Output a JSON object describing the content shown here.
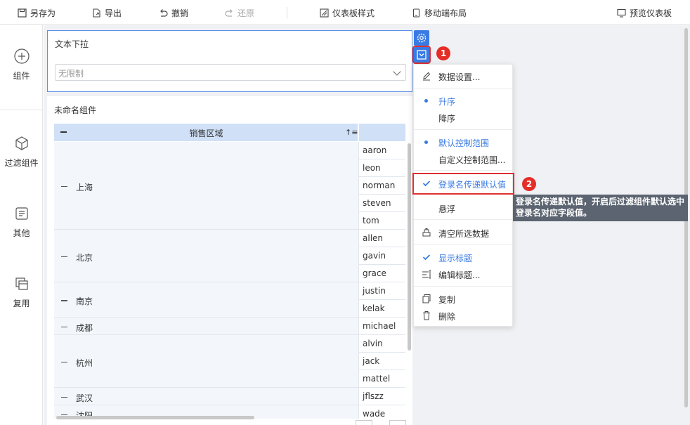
{
  "toolbar": {
    "save_as": "另存为",
    "export": "导出",
    "undo": "撤销",
    "redo": "还原",
    "dashboard_style": "仪表板样式",
    "mobile_layout": "移动端布局",
    "preview": "预览仪表板"
  },
  "sidebar": {
    "items": [
      {
        "label": "组件",
        "icon": "plus-circle-icon"
      },
      {
        "label": "过滤组件",
        "icon": "cube-icon"
      },
      {
        "label": "其他",
        "icon": "document-icon"
      },
      {
        "label": "复用",
        "icon": "layers-icon"
      }
    ]
  },
  "dropdown_widget": {
    "title": "文本下拉",
    "placeholder": "无限制"
  },
  "table_widget": {
    "title": "未命名组件",
    "header": "销售区域",
    "groups": [
      {
        "region": "上海",
        "names": [
          "aaron",
          "leon",
          "norman",
          "steven",
          "tom"
        ]
      },
      {
        "region": "北京",
        "names": [
          "allen",
          "gavin",
          "grace"
        ]
      },
      {
        "region": "南京",
        "names": [
          "justin",
          "kelak"
        ]
      },
      {
        "region": "成都",
        "names": [
          "michael"
        ]
      },
      {
        "region": "杭州",
        "names": [
          "alvin",
          "jack",
          "mattel"
        ]
      },
      {
        "region": "武汉",
        "names": [
          "jflszz"
        ]
      },
      {
        "region": "沈阳",
        "names": [
          "wade"
        ]
      }
    ]
  },
  "menu": {
    "data_settings": "数据设置...",
    "asc": "升序",
    "desc": "降序",
    "default_range": "默认控制范围",
    "custom_range": "自定义控制范围...",
    "login_default": "登录名传递默认值",
    "float": "悬浮",
    "clear_selected": "清空所选数据",
    "show_title": "显示标题",
    "edit_title": "编辑标题...",
    "copy": "复制",
    "delete": "删除"
  },
  "badges": {
    "one": "1",
    "two": "2"
  },
  "tooltip": {
    "line1": "登录名传递默认值，开启后过滤组件默认选中",
    "line2": "登录名对应字段值。"
  },
  "colors": {
    "accent": "#3a7be3",
    "highlight": "#e03030",
    "header_bg": "#cfe0f7"
  }
}
